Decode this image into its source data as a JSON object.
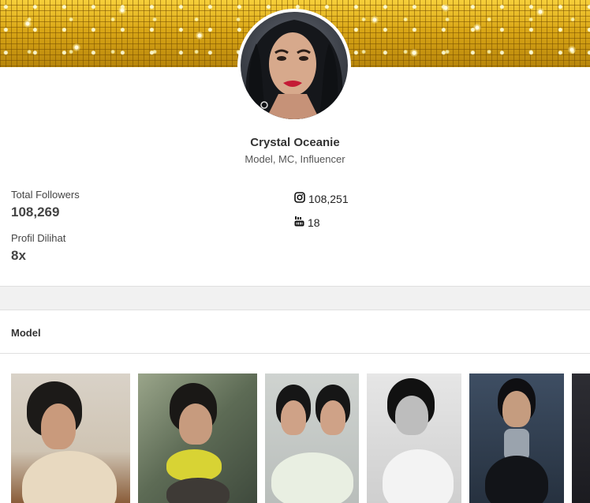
{
  "profile": {
    "name": "Crystal Oceanie",
    "role": "Model, MC, Influencer"
  },
  "stats": {
    "followers_label": "Total Followers",
    "followers_value": "108,269",
    "views_label": "Profil Dilihat",
    "views_value": "8x"
  },
  "social": {
    "instagram": {
      "icon": "instagram-icon",
      "count": "108,251"
    },
    "youtube": {
      "icon": "youtube-icon",
      "count": "18"
    }
  },
  "section": {
    "title": "Model"
  },
  "gallery": [
    {
      "name": "photo-1"
    },
    {
      "name": "photo-2"
    },
    {
      "name": "photo-3"
    },
    {
      "name": "photo-4"
    },
    {
      "name": "photo-5"
    },
    {
      "name": "photo-6"
    }
  ],
  "colors": {
    "banner_gold": "#d9a616",
    "text_dark": "#333333",
    "divider": "#e0e0e0",
    "band": "#f1f1f1"
  }
}
